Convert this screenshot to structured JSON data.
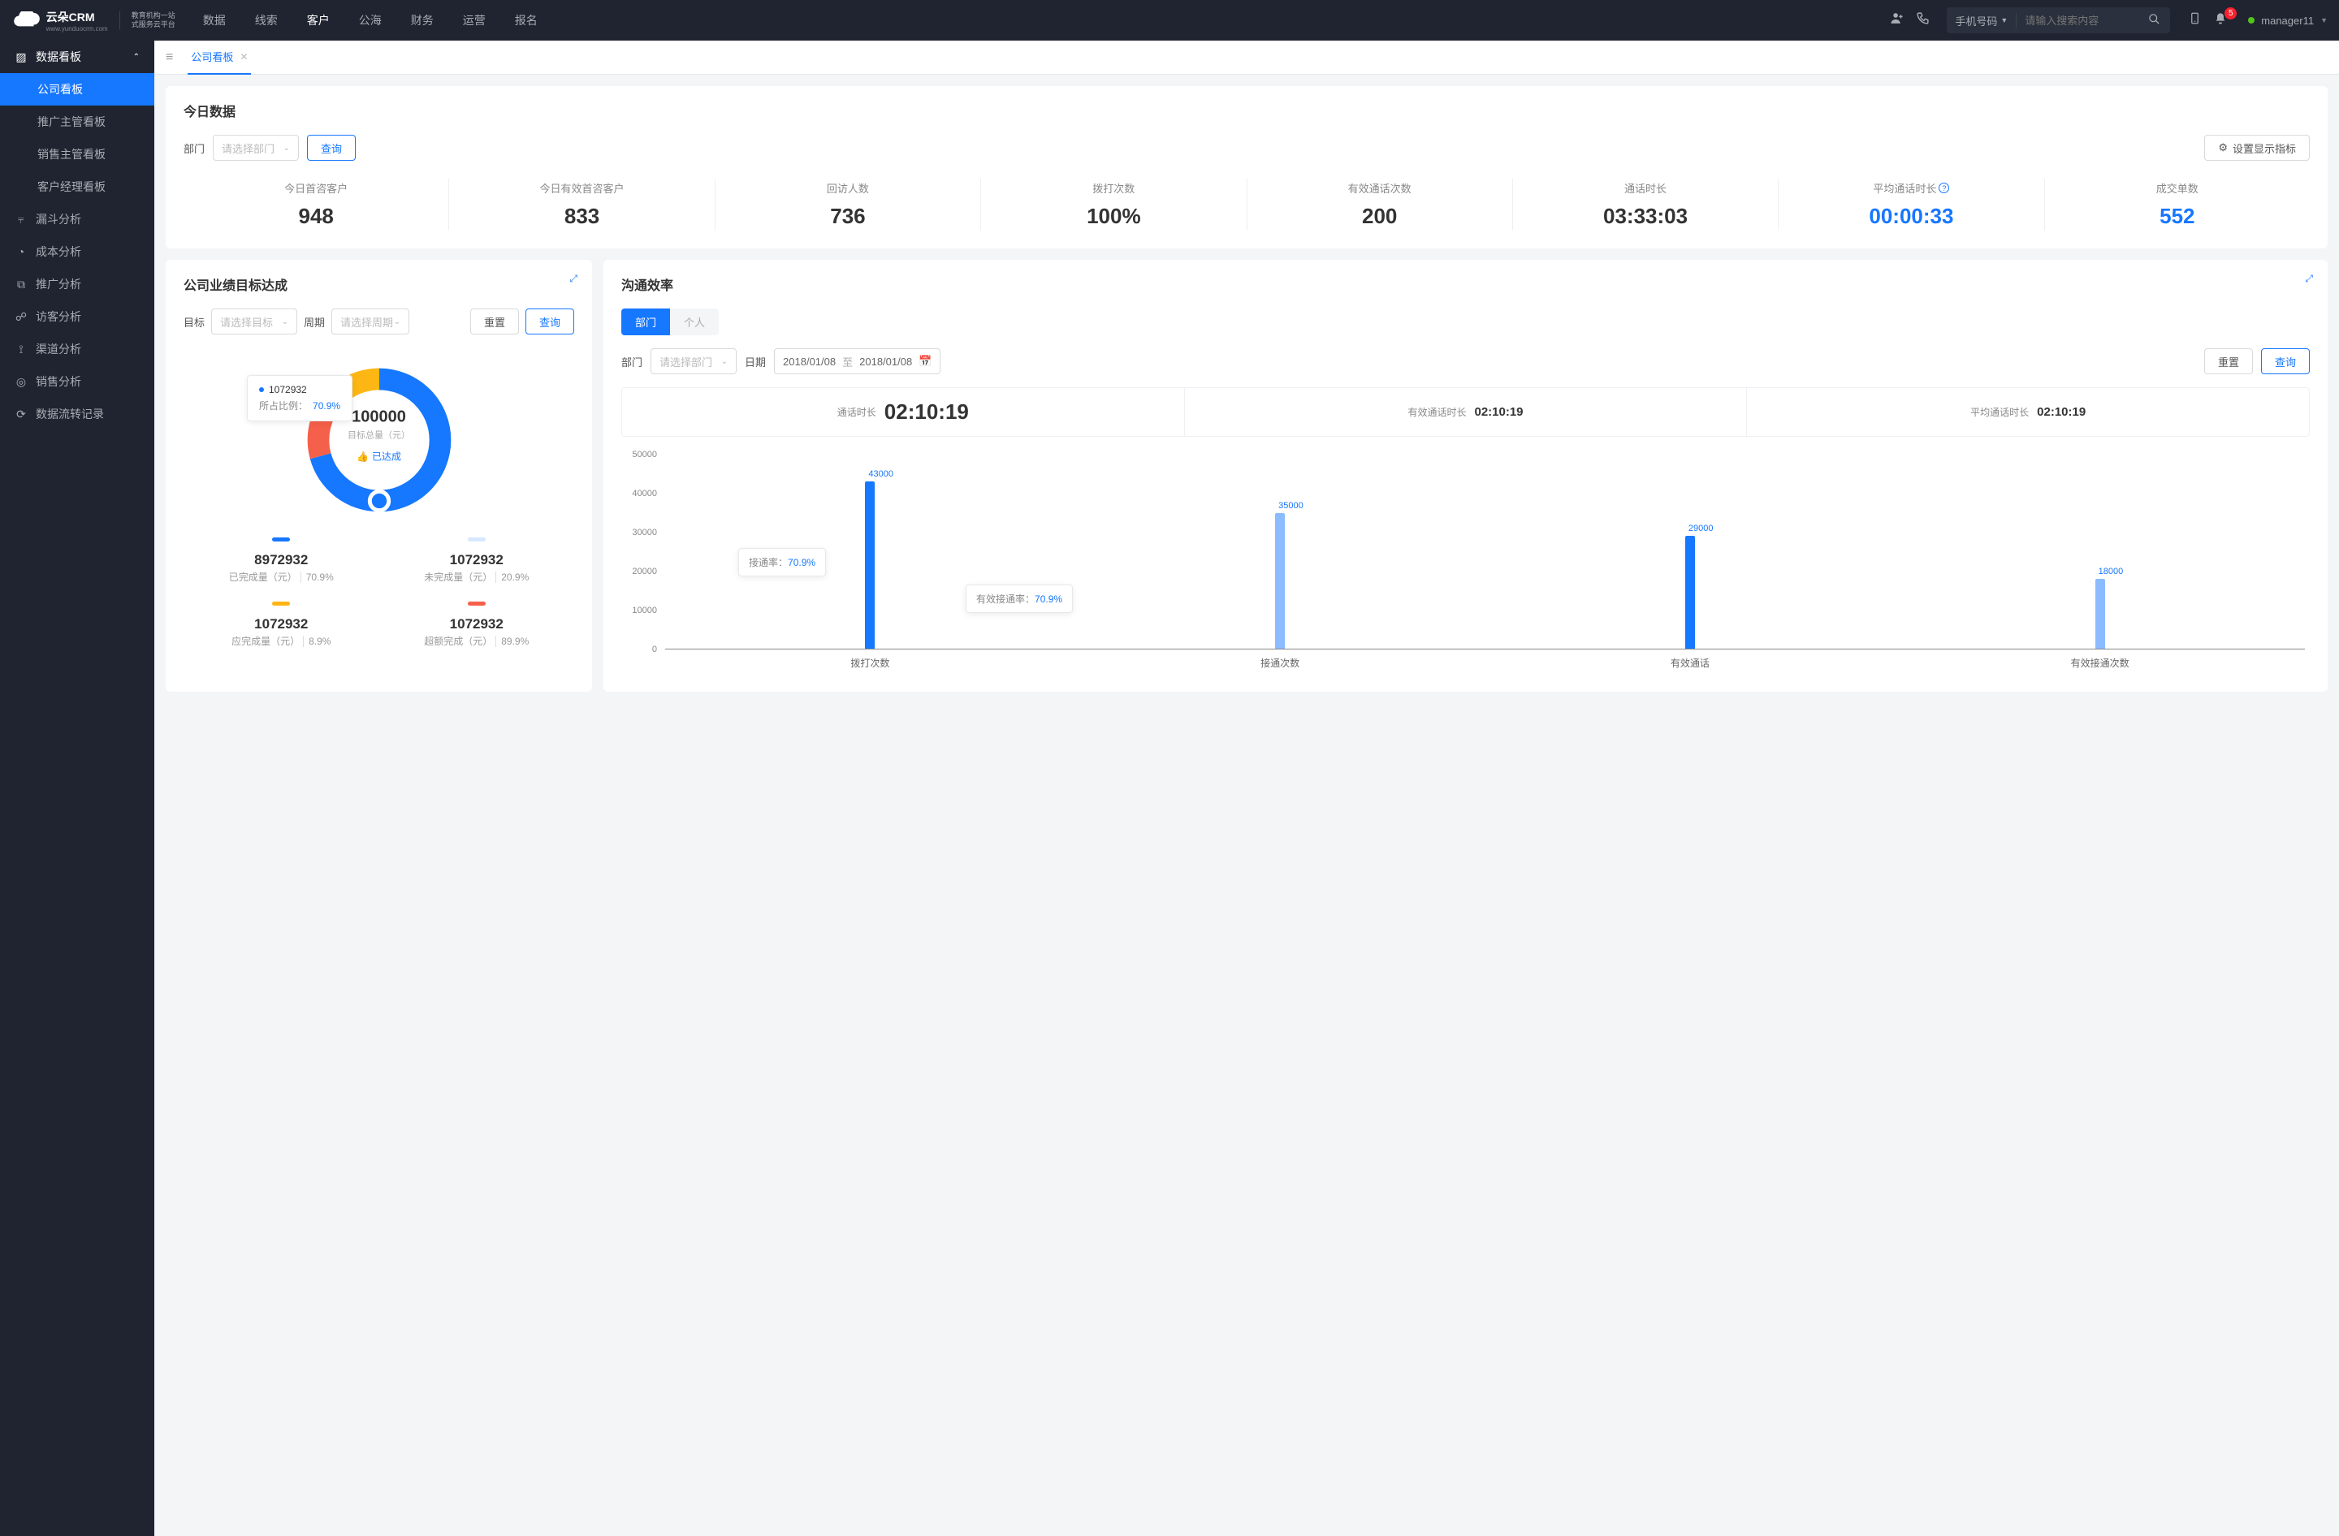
{
  "header": {
    "logo": "云朵CRM",
    "logo_url": "www.yunduocrm.com",
    "logo_sub1": "教育机构一站",
    "logo_sub2": "式服务云平台",
    "nav": [
      "数据",
      "线索",
      "客户",
      "公海",
      "财务",
      "运营",
      "报名"
    ],
    "nav_active": 2,
    "search_type": "手机号码",
    "search_placeholder": "请输入搜索内容",
    "badge": "5",
    "user": "manager11"
  },
  "sidebar": {
    "group": "数据看板",
    "subs": [
      "公司看板",
      "推广主管看板",
      "销售主管看板",
      "客户经理看板"
    ],
    "active_sub": 0,
    "items": [
      "漏斗分析",
      "成本分析",
      "推广分析",
      "访客分析",
      "渠道分析",
      "销售分析",
      "数据流转记录"
    ]
  },
  "tabs": {
    "active": "公司看板"
  },
  "today": {
    "title": "今日数据",
    "dept_label": "部门",
    "dept_placeholder": "请选择部门",
    "query": "查询",
    "settings": "设置显示指标",
    "stats": [
      {
        "label": "今日首咨客户",
        "value": "948",
        "color": "#333"
      },
      {
        "label": "今日有效首咨客户",
        "value": "833",
        "color": "#333"
      },
      {
        "label": "回访人数",
        "value": "736",
        "color": "#333"
      },
      {
        "label": "拨打次数",
        "value": "100%",
        "color": "#333"
      },
      {
        "label": "有效通话次数",
        "value": "200",
        "color": "#333"
      },
      {
        "label": "通话时长",
        "value": "03:33:03",
        "color": "#333"
      },
      {
        "label": "平均通话时长",
        "value": "00:00:33",
        "color": "#1677ff",
        "info": true
      },
      {
        "label": "成交单数",
        "value": "552",
        "color": "#1677ff"
      }
    ]
  },
  "goal": {
    "title": "公司业绩目标达成",
    "target_label": "目标",
    "target_ph": "请选择目标",
    "period_label": "周期",
    "period_ph": "请选择周期",
    "reset": "重置",
    "query": "查询",
    "tooltip_value": "1072932",
    "tooltip_label": "所占比例：",
    "tooltip_pct": "70.9%",
    "center_value": "100000",
    "center_sub": "目标总量（元）",
    "center_badge": "已达成",
    "legend": [
      {
        "color": "#1677ff",
        "value": "8972932",
        "sub": "已完成量（元）",
        "pct": "70.9%"
      },
      {
        "color": "#d6e8ff",
        "value": "1072932",
        "sub": "未完成量（元）",
        "pct": "20.9%"
      },
      {
        "color": "#fdb614",
        "value": "1072932",
        "sub": "应完成量（元）",
        "pct": "8.9%"
      },
      {
        "color": "#f5604a",
        "value": "1072932",
        "sub": "超额完成（元）",
        "pct": "89.9%"
      }
    ]
  },
  "eff": {
    "title": "沟通效率",
    "seg": [
      "部门",
      "个人"
    ],
    "seg_active": 0,
    "dept_label": "部门",
    "dept_ph": "请选择部门",
    "date_label": "日期",
    "date_from": "2018/01/08",
    "date_sep": "至",
    "date_to": "2018/01/08",
    "reset": "重置",
    "query": "查询",
    "kpis": [
      {
        "label": "通话时长",
        "value": "02:10:19",
        "big": true
      },
      {
        "label": "有效通话时长",
        "value": "02:10:19"
      },
      {
        "label": "平均通话时长",
        "value": "02:10:19"
      }
    ],
    "tip1_label": "接通率：",
    "tip1_val": "70.9%",
    "tip2_label": "有效接通率：",
    "tip2_val": "70.9%"
  },
  "chart_data": [
    {
      "type": "pie",
      "title": "公司业绩目标达成",
      "series": [
        {
          "name": "已完成量（元）",
          "value": 8972932,
          "pct": 70.9,
          "color": "#1677ff"
        },
        {
          "name": "未完成量（元）",
          "value": 1072932,
          "pct": 20.9,
          "color": "#d6e8ff"
        },
        {
          "name": "超额完成（元）",
          "value": 1072932,
          "pct": 89.9,
          "color": "#f5604a"
        },
        {
          "name": "应完成量（元）",
          "value": 1072932,
          "pct": 8.9,
          "color": "#fdb614"
        }
      ],
      "center_total": 100000,
      "center_label": "目标总量（元）"
    },
    {
      "type": "bar",
      "title": "沟通效率",
      "categories": [
        "拨打次数",
        "接通次数",
        "有效通话",
        "有效接通次数"
      ],
      "values": [
        43000,
        35000,
        29000,
        18000
      ],
      "ylabel": "",
      "ylim": [
        0,
        50000
      ],
      "yticks": [
        0,
        10000,
        20000,
        30000,
        40000,
        50000
      ]
    }
  ]
}
